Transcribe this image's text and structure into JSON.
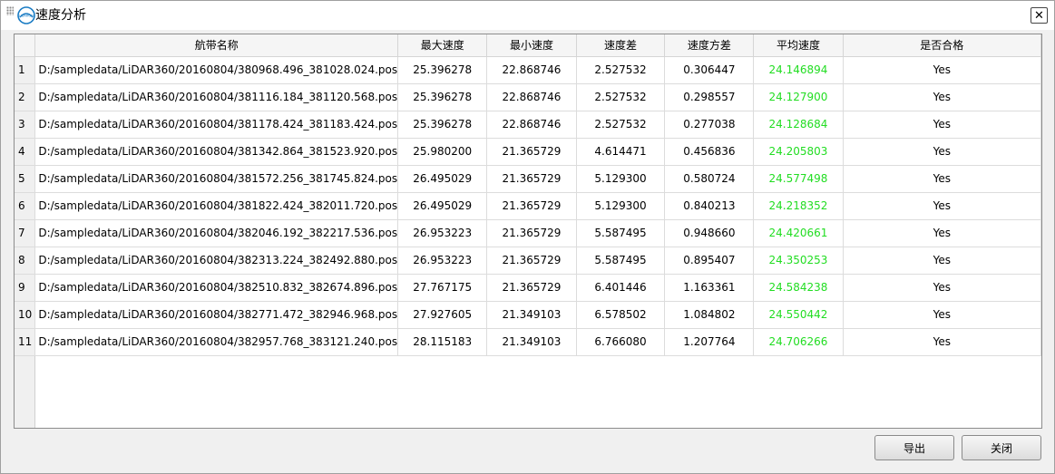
{
  "window": {
    "title": "速度分析",
    "logo_text": "LIDARGIS",
    "close_symbol": "✕"
  },
  "table": {
    "columns": [
      "航带名称",
      "最大速度",
      "最小速度",
      "速度差",
      "速度方差",
      "平均速度",
      "是否合格"
    ],
    "rows": [
      {
        "num": "1",
        "name": "D:/sampledata/LiDAR360/20160804/380968.496_381028.024.pos",
        "max": "25.396278",
        "min": "22.868746",
        "diff": "2.527532",
        "var": "0.306447",
        "avg": "24.146894",
        "ok": "Yes"
      },
      {
        "num": "2",
        "name": "D:/sampledata/LiDAR360/20160804/381116.184_381120.568.pos",
        "max": "25.396278",
        "min": "22.868746",
        "diff": "2.527532",
        "var": "0.298557",
        "avg": "24.127900",
        "ok": "Yes"
      },
      {
        "num": "3",
        "name": "D:/sampledata/LiDAR360/20160804/381178.424_381183.424.pos",
        "max": "25.396278",
        "min": "22.868746",
        "diff": "2.527532",
        "var": "0.277038",
        "avg": "24.128684",
        "ok": "Yes"
      },
      {
        "num": "4",
        "name": "D:/sampledata/LiDAR360/20160804/381342.864_381523.920.pos",
        "max": "25.980200",
        "min": "21.365729",
        "diff": "4.614471",
        "var": "0.456836",
        "avg": "24.205803",
        "ok": "Yes"
      },
      {
        "num": "5",
        "name": "D:/sampledata/LiDAR360/20160804/381572.256_381745.824.pos",
        "max": "26.495029",
        "min": "21.365729",
        "diff": "5.129300",
        "var": "0.580724",
        "avg": "24.577498",
        "ok": "Yes"
      },
      {
        "num": "6",
        "name": "D:/sampledata/LiDAR360/20160804/381822.424_382011.720.pos",
        "max": "26.495029",
        "min": "21.365729",
        "diff": "5.129300",
        "var": "0.840213",
        "avg": "24.218352",
        "ok": "Yes"
      },
      {
        "num": "7",
        "name": "D:/sampledata/LiDAR360/20160804/382046.192_382217.536.pos",
        "max": "26.953223",
        "min": "21.365729",
        "diff": "5.587495",
        "var": "0.948660",
        "avg": "24.420661",
        "ok": "Yes"
      },
      {
        "num": "8",
        "name": "D:/sampledata/LiDAR360/20160804/382313.224_382492.880.pos",
        "max": "26.953223",
        "min": "21.365729",
        "diff": "5.587495",
        "var": "0.895407",
        "avg": "24.350253",
        "ok": "Yes"
      },
      {
        "num": "9",
        "name": "D:/sampledata/LiDAR360/20160804/382510.832_382674.896.pos",
        "max": "27.767175",
        "min": "21.365729",
        "diff": "6.401446",
        "var": "1.163361",
        "avg": "24.584238",
        "ok": "Yes"
      },
      {
        "num": "10",
        "name": "D:/sampledata/LiDAR360/20160804/382771.472_382946.968.pos",
        "max": "27.927605",
        "min": "21.349103",
        "diff": "6.578502",
        "var": "1.084802",
        "avg": "24.550442",
        "ok": "Yes"
      },
      {
        "num": "11",
        "name": "D:/sampledata/LiDAR360/20160804/382957.768_383121.240.pos",
        "max": "28.115183",
        "min": "21.349103",
        "diff": "6.766080",
        "var": "1.207764",
        "avg": "24.706266",
        "ok": "Yes"
      }
    ]
  },
  "buttons": {
    "export_label": "导出",
    "close_label": "关闭"
  },
  "colors": {
    "avg_speed_text": "#22dd22",
    "logo_blue": "#1a7cc4"
  }
}
